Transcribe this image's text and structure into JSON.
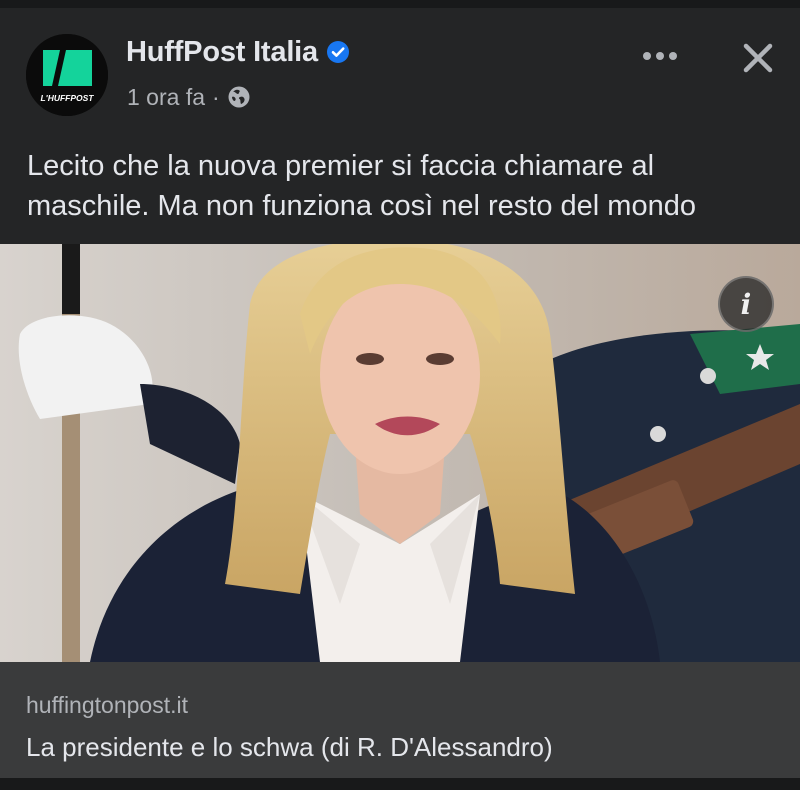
{
  "post": {
    "page_name": "HuffPost Italia",
    "avatar_label": "L'HUFFPOST",
    "time": "1 ora fa",
    "separator": "·",
    "text": "Lecito che la nuova premier si faccia chiamare al maschile. Ma non funziona così nel resto del mondo",
    "icons": {
      "verified": "verified-badge-icon",
      "audience": "globe-icon",
      "more": "more-options-icon",
      "close": "close-icon",
      "info": "info-icon"
    }
  },
  "link_preview": {
    "domain": "huffingtonpost.it",
    "title": "La presidente e lo schwa (di R. D'Alessandro)"
  },
  "colors": {
    "background": "#18191a",
    "card": "#242526",
    "link_box": "#3a3b3c",
    "text_primary": "#e4e6eb",
    "text_secondary": "#b0b3b8",
    "verified": "#1877f2",
    "brand_green": "#14d39b"
  }
}
